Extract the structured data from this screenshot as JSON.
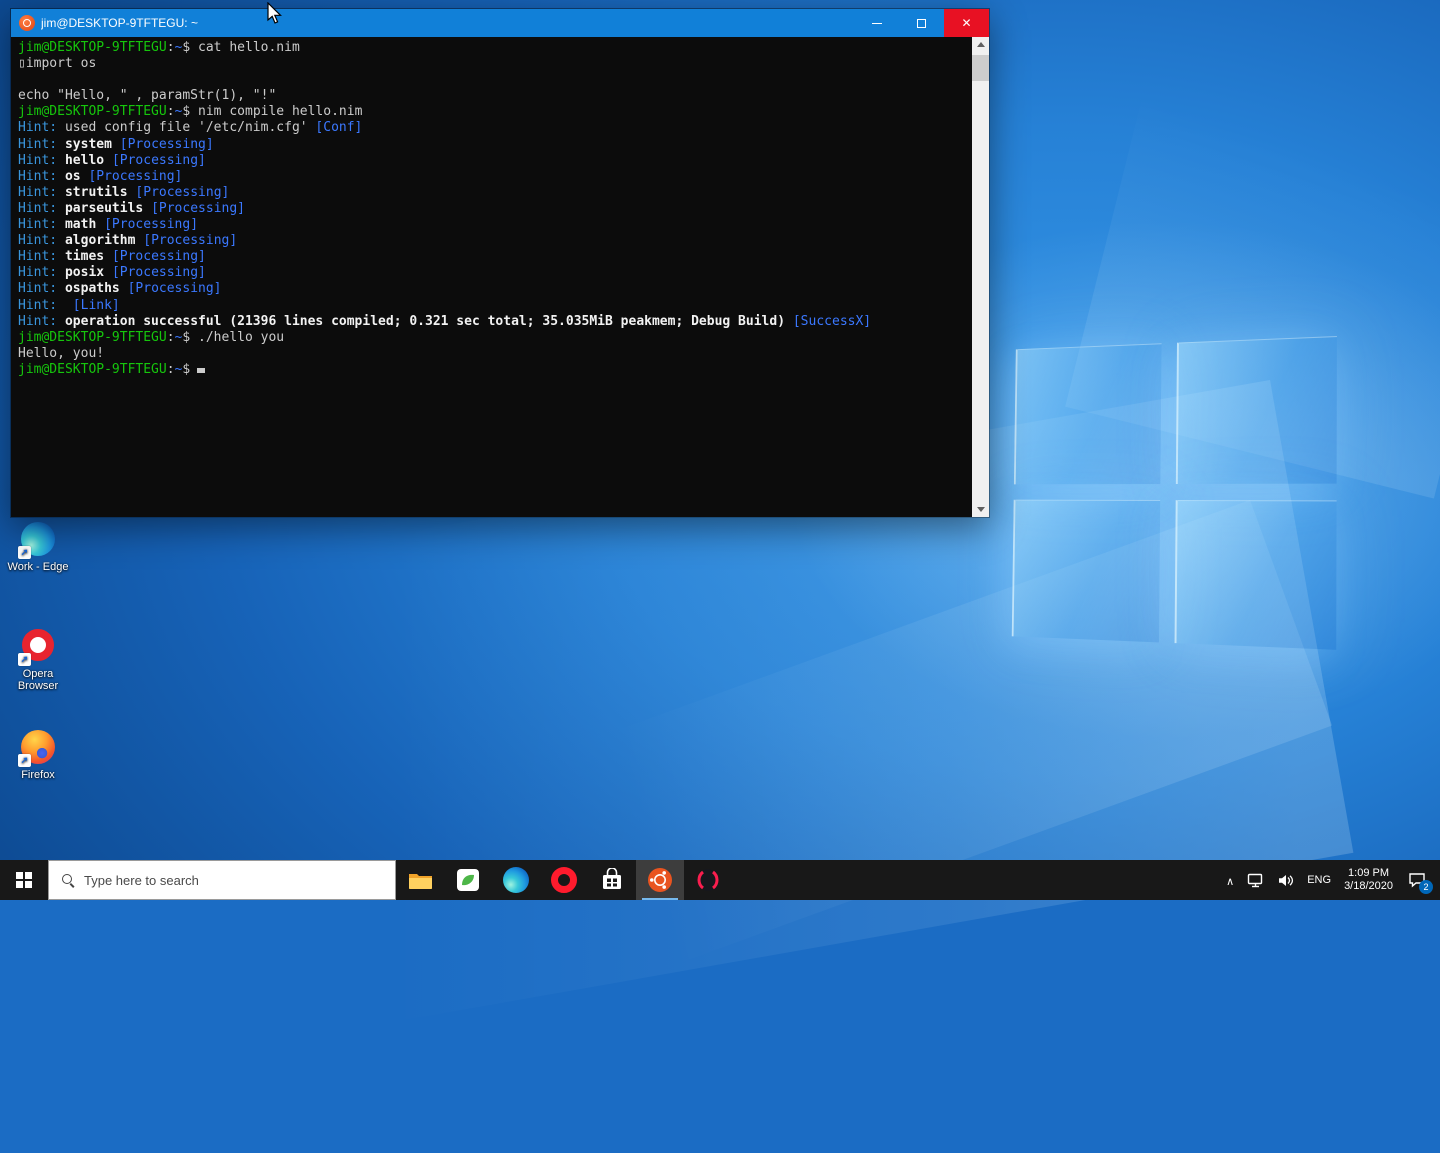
{
  "window": {
    "title": "jim@DESKTOP-9TFTEGU: ~"
  },
  "terminal": {
    "palette": {
      "fg": "#CCCCCC",
      "green": "#16C60C",
      "blue": "#3B78FF",
      "cyan": "#3A96DD",
      "white": "#F2F2F2"
    },
    "lines": [
      {
        "segments": [
          {
            "t": "jim@DESKTOP-9TFTEGU",
            "c": "green"
          },
          {
            "t": ":",
            "c": "fg"
          },
          {
            "t": "~",
            "c": "blue"
          },
          {
            "t": "$ ",
            "c": "fg"
          },
          {
            "t": "cat hello.nim",
            "c": "fg"
          }
        ]
      },
      {
        "segments": [
          {
            "t": "▯import os",
            "c": "fg"
          }
        ]
      },
      {
        "segments": []
      },
      {
        "segments": [
          {
            "t": "echo \"Hello, \" , paramStr(1), \"!\"",
            "c": "fg"
          }
        ]
      },
      {
        "segments": [
          {
            "t": "jim@DESKTOP-9TFTEGU",
            "c": "green"
          },
          {
            "t": ":",
            "c": "fg"
          },
          {
            "t": "~",
            "c": "blue"
          },
          {
            "t": "$ ",
            "c": "fg"
          },
          {
            "t": "nim compile hello.nim",
            "c": "fg"
          }
        ]
      },
      {
        "segments": [
          {
            "t": "Hint: ",
            "c": "cyan"
          },
          {
            "t": "used config file '/etc/nim.cfg' ",
            "c": "fg"
          },
          {
            "t": "[Conf]",
            "c": "blue"
          }
        ]
      },
      {
        "segments": [
          {
            "t": "Hint: ",
            "c": "cyan"
          },
          {
            "t": "system",
            "c": "white",
            "b": true
          },
          {
            "t": " ",
            "c": "fg"
          },
          {
            "t": "[Processing]",
            "c": "blue"
          }
        ]
      },
      {
        "segments": [
          {
            "t": "Hint: ",
            "c": "cyan"
          },
          {
            "t": "hello",
            "c": "white",
            "b": true
          },
          {
            "t": " ",
            "c": "fg"
          },
          {
            "t": "[Processing]",
            "c": "blue"
          }
        ]
      },
      {
        "segments": [
          {
            "t": "Hint: ",
            "c": "cyan"
          },
          {
            "t": "os",
            "c": "white",
            "b": true
          },
          {
            "t": " ",
            "c": "fg"
          },
          {
            "t": "[Processing]",
            "c": "blue"
          }
        ]
      },
      {
        "segments": [
          {
            "t": "Hint: ",
            "c": "cyan"
          },
          {
            "t": "strutils",
            "c": "white",
            "b": true
          },
          {
            "t": " ",
            "c": "fg"
          },
          {
            "t": "[Processing]",
            "c": "blue"
          }
        ]
      },
      {
        "segments": [
          {
            "t": "Hint: ",
            "c": "cyan"
          },
          {
            "t": "parseutils",
            "c": "white",
            "b": true
          },
          {
            "t": " ",
            "c": "fg"
          },
          {
            "t": "[Processing]",
            "c": "blue"
          }
        ]
      },
      {
        "segments": [
          {
            "t": "Hint: ",
            "c": "cyan"
          },
          {
            "t": "math",
            "c": "white",
            "b": true
          },
          {
            "t": " ",
            "c": "fg"
          },
          {
            "t": "[Processing]",
            "c": "blue"
          }
        ]
      },
      {
        "segments": [
          {
            "t": "Hint: ",
            "c": "cyan"
          },
          {
            "t": "algorithm",
            "c": "white",
            "b": true
          },
          {
            "t": " ",
            "c": "fg"
          },
          {
            "t": "[Processing]",
            "c": "blue"
          }
        ]
      },
      {
        "segments": [
          {
            "t": "Hint: ",
            "c": "cyan"
          },
          {
            "t": "times",
            "c": "white",
            "b": true
          },
          {
            "t": " ",
            "c": "fg"
          },
          {
            "t": "[Processing]",
            "c": "blue"
          }
        ]
      },
      {
        "segments": [
          {
            "t": "Hint: ",
            "c": "cyan"
          },
          {
            "t": "posix",
            "c": "white",
            "b": true
          },
          {
            "t": " ",
            "c": "fg"
          },
          {
            "t": "[Processing]",
            "c": "blue"
          }
        ]
      },
      {
        "segments": [
          {
            "t": "Hint: ",
            "c": "cyan"
          },
          {
            "t": "ospaths",
            "c": "white",
            "b": true
          },
          {
            "t": " ",
            "c": "fg"
          },
          {
            "t": "[Processing]",
            "c": "blue"
          }
        ]
      },
      {
        "segments": [
          {
            "t": "Hint:  ",
            "c": "cyan"
          },
          {
            "t": "[Link]",
            "c": "blue"
          }
        ]
      },
      {
        "segments": [
          {
            "t": "Hint: ",
            "c": "cyan"
          },
          {
            "t": "operation successful (21396 lines compiled; 0.321 sec total; 35.035MiB peakmem; Debug Build)",
            "c": "white",
            "b": true
          },
          {
            "t": " ",
            "c": "fg"
          },
          {
            "t": "[SuccessX]",
            "c": "blue"
          }
        ]
      },
      {
        "segments": [
          {
            "t": "jim@DESKTOP-9TFTEGU",
            "c": "green"
          },
          {
            "t": ":",
            "c": "fg"
          },
          {
            "t": "~",
            "c": "blue"
          },
          {
            "t": "$ ",
            "c": "fg"
          },
          {
            "t": "./hello you",
            "c": "fg"
          }
        ]
      },
      {
        "segments": [
          {
            "t": "Hello, you!",
            "c": "fg"
          }
        ]
      },
      {
        "segments": [
          {
            "t": "jim@DESKTOP-9TFTEGU",
            "c": "green"
          },
          {
            "t": ":",
            "c": "fg"
          },
          {
            "t": "~",
            "c": "blue"
          },
          {
            "t": "$",
            "c": "fg"
          }
        ],
        "cursor": true
      }
    ]
  },
  "desktop": {
    "icons": [
      {
        "label": "Work - Edge"
      },
      {
        "label": "Opera Browser"
      },
      {
        "label": "Firefox"
      }
    ]
  },
  "taskbar": {
    "search_placeholder": "Type here to search",
    "apps": [
      "file-explorer",
      "green-app",
      "edge",
      "opera",
      "microsoft-store",
      "ubuntu-terminal",
      "opera-gx"
    ],
    "tray": {
      "language": "ENG",
      "time": "1:09 PM",
      "date": "3/18/2020",
      "notification_count": "2"
    }
  }
}
